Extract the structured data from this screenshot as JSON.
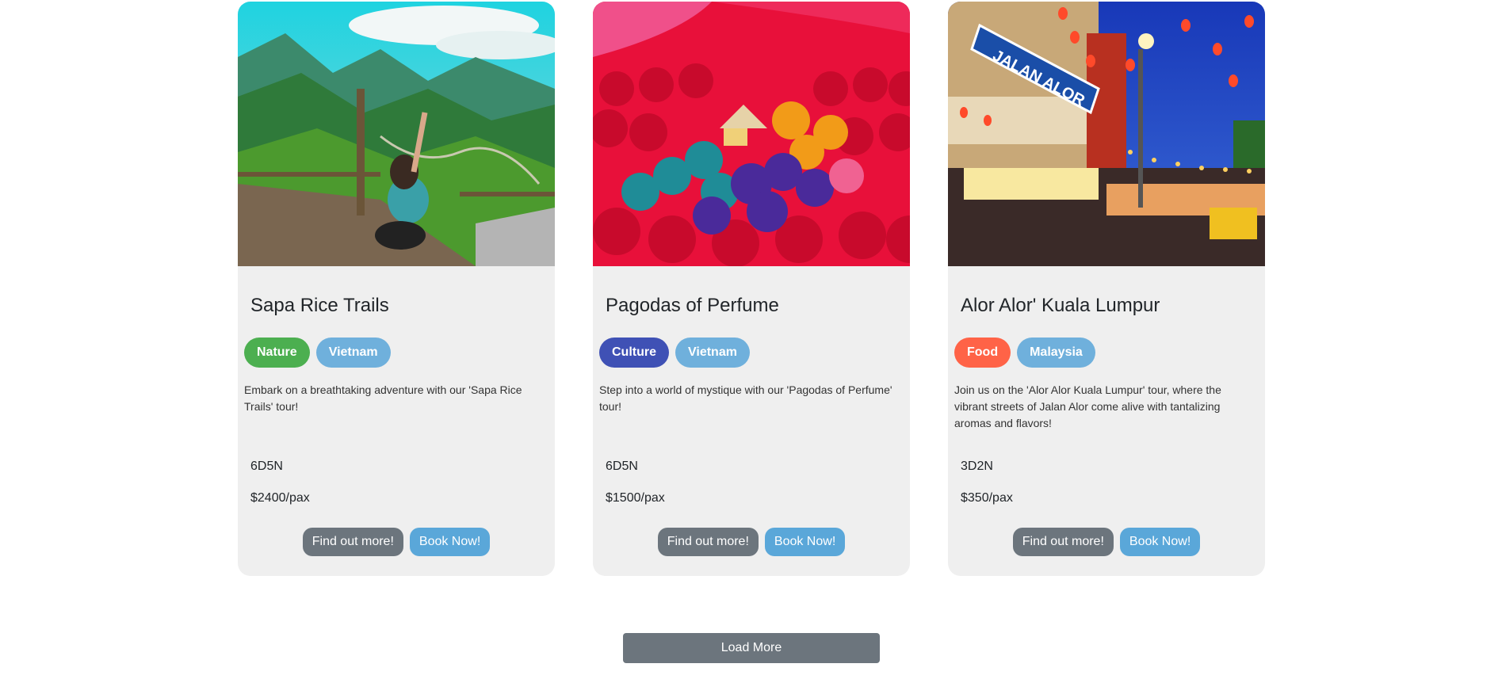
{
  "cards": [
    {
      "title": "Sapa Rice Trails",
      "tags": [
        {
          "label": "Nature",
          "color": "#4caf50"
        },
        {
          "label": "Vietnam",
          "color": "#6fb0dc"
        }
      ],
      "description": "Embark on a breathtaking adventure with our 'Sapa Rice Trails' tour!",
      "duration": "6D5N",
      "price": "$2400/pax",
      "find_out_label": "Find out more!",
      "book_label": "Book Now!"
    },
    {
      "title": "Pagodas of Perfume",
      "tags": [
        {
          "label": "Culture",
          "color": "#3f51b5"
        },
        {
          "label": "Vietnam",
          "color": "#6fb0dc"
        }
      ],
      "description": "Step into a world of mystique with our 'Pagodas of Perfume' tour!",
      "duration": "6D5N",
      "price": "$1500/pax",
      "find_out_label": "Find out more!",
      "book_label": "Book Now!"
    },
    {
      "title": "Alor Alor' Kuala Lumpur",
      "tags": [
        {
          "label": "Food",
          "color": "#ff6347"
        },
        {
          "label": "Malaysia",
          "color": "#6fb0dc"
        }
      ],
      "description": "Join us on the 'Alor Alor Kuala Lumpur' tour, where the vibrant streets of Jalan Alor come alive with tantalizing aromas and flavors!",
      "duration": "3D2N",
      "price": "$350/pax",
      "find_out_label": "Find out more!",
      "book_label": "Book Now!",
      "image_sign_text": "JALAN ALOR"
    }
  ],
  "load_more_label": "Load More",
  "colors": {
    "card_bg": "#efefef",
    "button_grey": "#6c757d",
    "button_blue": "#5aa7d9"
  }
}
